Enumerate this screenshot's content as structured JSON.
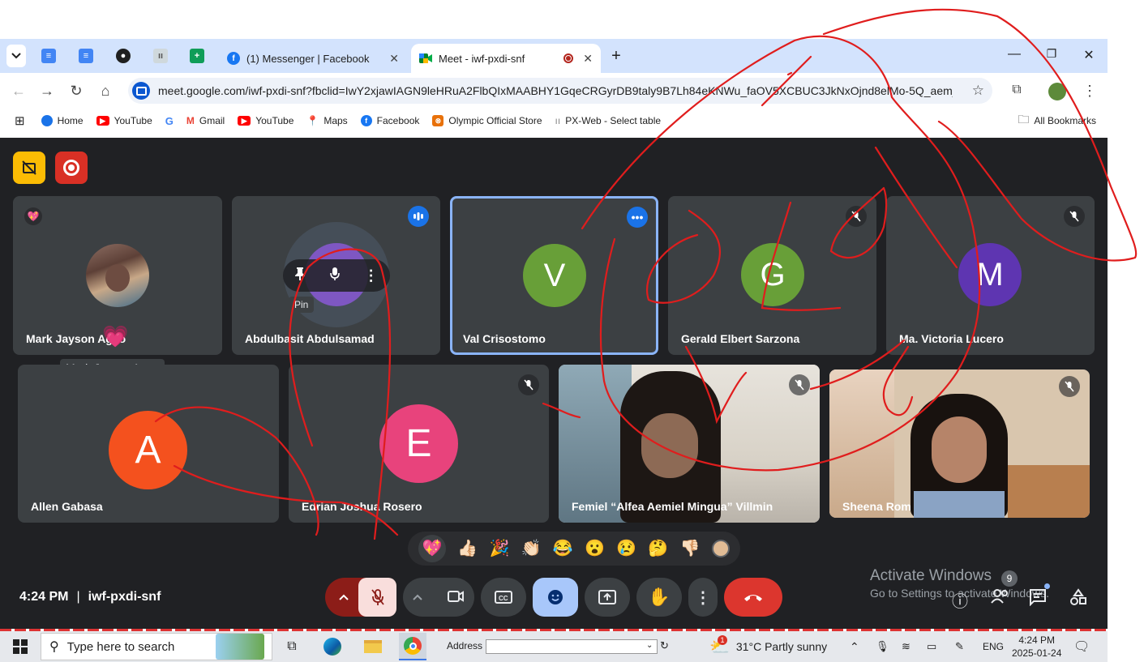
{
  "browser": {
    "tabs": [
      {
        "title": "(1) Messenger | Facebook",
        "active": false
      },
      {
        "title": "Meet - iwf-pxdi-snf",
        "active": true
      }
    ],
    "new_tab": "+",
    "url": "meet.google.com/iwf-pxdi-snf?fbclid=IwY2xjawIAGN9leHRuA2FlbQIxMAABHY1GqeCRGyrDB9taly9B7Lh84eKNWu_faOV5XCBUC3JkNxOjnd8elMo-5Q_aem_pm...",
    "bookmarks": [
      {
        "label": "Home",
        "icon": "edge-icon",
        "color": "#1a73e8"
      },
      {
        "label": "YouTube",
        "icon": "youtube-icon",
        "color": "#ff0000"
      },
      {
        "label": "",
        "icon": "google-icon",
        "color": "#4285f4"
      },
      {
        "label": "Gmail",
        "icon": "gmail-icon",
        "color": "#ea4335"
      },
      {
        "label": "YouTube",
        "icon": "youtube-icon",
        "color": "#ff0000"
      },
      {
        "label": "Maps",
        "icon": "maps-icon",
        "color": "#34a853"
      },
      {
        "label": "Facebook",
        "icon": "facebook-icon",
        "color": "#1877f2"
      },
      {
        "label": "Olympic Official Store",
        "icon": "store-icon",
        "color": "#e8710a"
      },
      {
        "label": "PX-Web - Select table",
        "icon": "pxweb-icon",
        "color": "#9e9e9e"
      }
    ],
    "all_bookmarks": "All Bookmarks"
  },
  "meet": {
    "participants": [
      {
        "name": "Mark Jayson Agao",
        "type": "photo"
      },
      {
        "name": "Abdulbasit Abdulsamad",
        "type": "avatar",
        "initial": "A",
        "speaking": true
      },
      {
        "name": "Val Crisostomo",
        "type": "avatar",
        "initial": "V",
        "color": "#689f38",
        "active": true
      },
      {
        "name": "Gerald Elbert Sarzona",
        "type": "avatar",
        "initial": "G",
        "color": "#689f38",
        "muted": true
      },
      {
        "name": "Ma. Victoria Lucero",
        "type": "avatar",
        "initial": "M",
        "color": "#5e35b1",
        "muted": true
      },
      {
        "name": "Allen Gabasa",
        "type": "avatar",
        "initial": "A",
        "color": "#f4511e"
      },
      {
        "name": "Edrian Joshua Rosero",
        "type": "avatar",
        "initial": "E",
        "color": "#e8437c",
        "muted": true
      },
      {
        "name": "Femiel “Alfea Aemiel Mingua” Villmin",
        "type": "video",
        "muted": true
      },
      {
        "name": "Sheena Rom",
        "type": "video",
        "muted": true
      }
    ],
    "hover_tooltip": "Pin",
    "name_tooltip": "Mark Jayson Agao",
    "reactions": [
      "💖",
      "👍🏻",
      "🎉",
      "👏🏻",
      "😂",
      "😮",
      "😢",
      "🤔",
      "👎🏻"
    ],
    "time": "4:24 PM",
    "meeting_code": "iwf-pxdi-snf",
    "activate_title": "Activate Windows",
    "activate_sub": "Go to Settings to activate Windows.",
    "participants_count": "9",
    "colors": {
      "mic_off": "#f9dedc",
      "mic_off_arrow": "#8c1d18",
      "reaction_active": "#a8c7fa",
      "leave": "#dc362e"
    }
  },
  "taskbar": {
    "search_placeholder": "Type here to search",
    "address_label": "Address",
    "weather": "31°C  Partly sunny",
    "weather_badge": "1",
    "lang": "ENG",
    "time": "4:24 PM",
    "date": "2025-01-24"
  }
}
